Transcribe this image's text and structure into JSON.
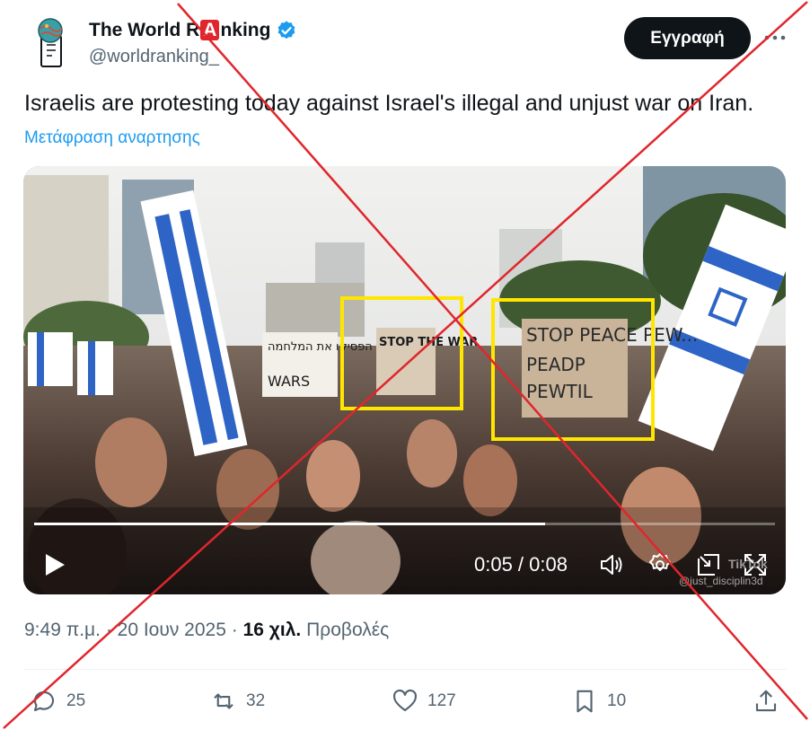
{
  "account": {
    "name_before": "The World R",
    "name_highlight": "A",
    "name_after": "nking",
    "handle": "@worldranking_",
    "verified_icon": "verified-badge-icon"
  },
  "follow_button": {
    "label": "Εγγραφή"
  },
  "more_icon": "more-dots-icon",
  "tweet": {
    "text": "Israelis are protesting today against Israel's illegal and unjust war on Iran.",
    "translate_link": "Μετάφραση αναρτησης"
  },
  "video": {
    "current_time": "0:05",
    "duration": "0:08",
    "time_display": "0:05 / 0:08",
    "progress": 0.69,
    "watermark": "@just_disciplin3d",
    "brand": "TikTok",
    "signs": {
      "left": "הפסיקו את המלחמה",
      "middle": "STOP THE WAR",
      "right": "STOP PEACE PEW..."
    },
    "icons": [
      "play-icon",
      "volume-icon",
      "settings-icon",
      "picture-in-picture-icon",
      "fullscreen-icon"
    ]
  },
  "meta": {
    "time": "9:49 π.μ.",
    "separator": "·",
    "date": "20 Ιουν 2025",
    "views_count": "16 χιλ.",
    "views_label": "Προβολές"
  },
  "actions": {
    "replies": "25",
    "reposts": "32",
    "likes": "127",
    "bookmarks": "10"
  },
  "colors": {
    "accent": "#1d9bf0",
    "text": "#0f1419",
    "muted": "#536471",
    "x_overlay": "#e0262c",
    "highlight_box": "#ffe600"
  }
}
